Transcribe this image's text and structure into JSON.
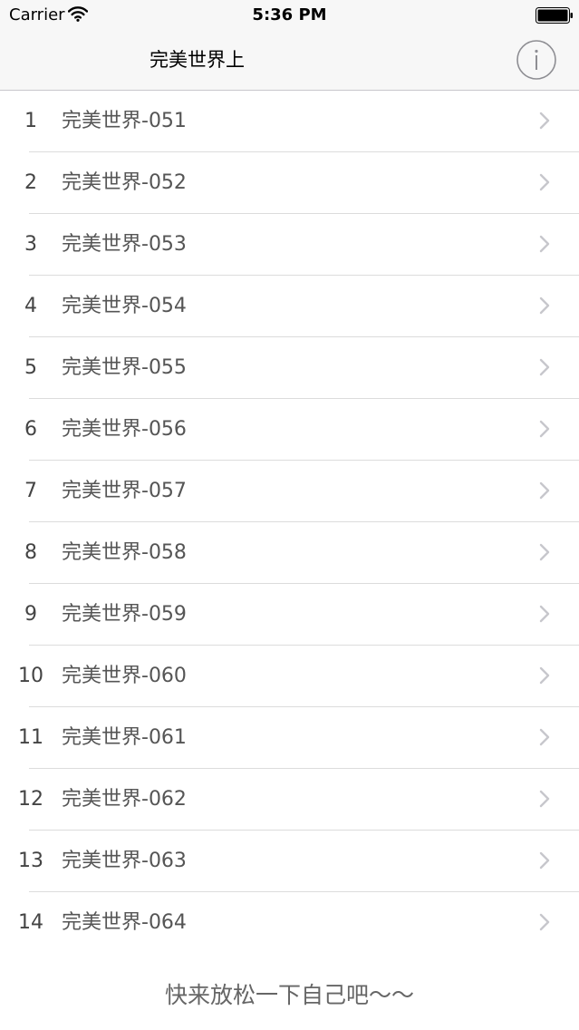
{
  "status_bar": {
    "carrier": "Carrier",
    "time": "5:36 PM",
    "wifi_icon": "wifi-icon",
    "battery_icon": "battery-icon"
  },
  "nav": {
    "title": "完美世界上",
    "info_icon": "info-icon"
  },
  "list": {
    "items": [
      {
        "number": "1",
        "title": "完美世界-051"
      },
      {
        "number": "2",
        "title": "完美世界-052"
      },
      {
        "number": "3",
        "title": "完美世界-053"
      },
      {
        "number": "4",
        "title": "完美世界-054"
      },
      {
        "number": "5",
        "title": "完美世界-055"
      },
      {
        "number": "6",
        "title": "完美世界-056"
      },
      {
        "number": "7",
        "title": "完美世界-057"
      },
      {
        "number": "8",
        "title": "完美世界-058"
      },
      {
        "number": "9",
        "title": "完美世界-059"
      },
      {
        "number": "10",
        "title": "完美世界-060"
      },
      {
        "number": "11",
        "title": "完美世界-061"
      },
      {
        "number": "12",
        "title": "完美世界-062"
      },
      {
        "number": "13",
        "title": "完美世界-063"
      },
      {
        "number": "14",
        "title": "完美世界-064"
      }
    ],
    "chevron_icon": "chevron-right-icon"
  },
  "footer": {
    "text": "快来放松一下自己吧～～"
  },
  "colors": {
    "bar_background": "#f7f7f7",
    "separator": "#dcdcdc",
    "chevron": "#c7c7cc",
    "text_primary": "#000000",
    "text_secondary": "#555555"
  }
}
